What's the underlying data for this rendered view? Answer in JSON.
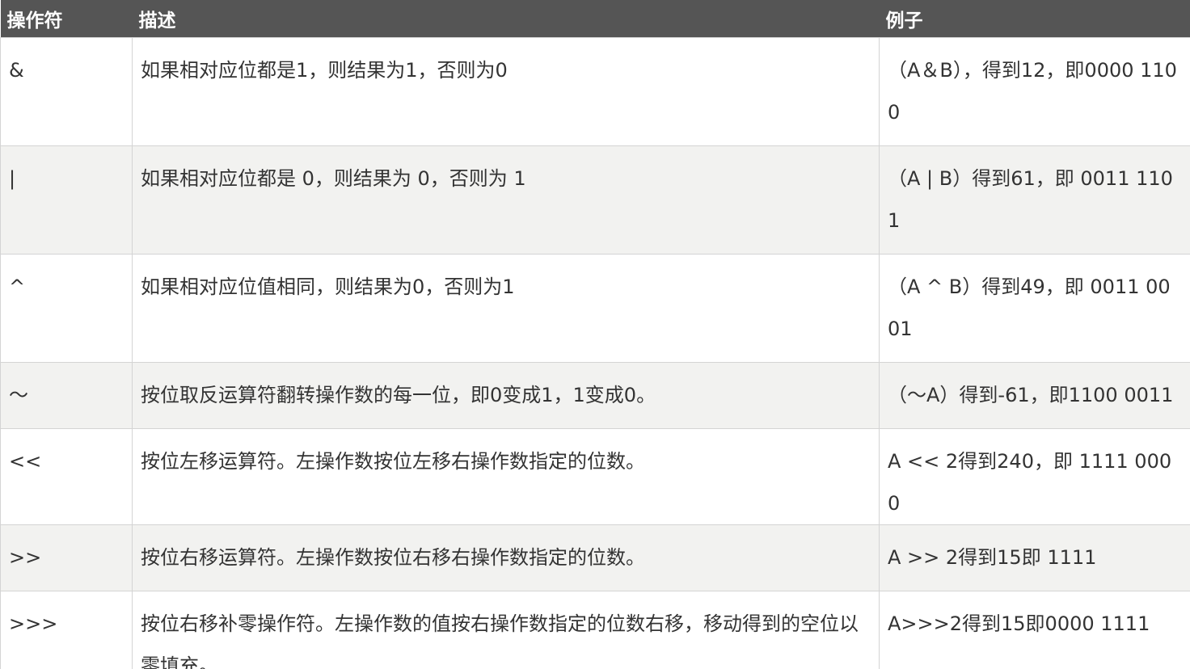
{
  "table": {
    "headers": [
      "操作符",
      "描述",
      "例子"
    ],
    "rows": [
      {
        "operator": "&",
        "description": "如果相对应位都是1，则结果为1，否则为0",
        "example": "（A＆B），得到12，即0000 1100"
      },
      {
        "operator": "|",
        "description": "如果相对应位都是 0，则结果为 0，否则为 1",
        "example": "（A | B）得到61，即 0011 1101"
      },
      {
        "operator": "^",
        "description": "如果相对应位值相同，则结果为0，否则为1",
        "example": "（A ^ B）得到49，即 0011 0001"
      },
      {
        "operator": "〜",
        "description": "按位取反运算符翻转操作数的每一位，即0变成1，1变成0。",
        "example": "（〜A）得到-61，即1100 0011"
      },
      {
        "operator": "<<",
        "description": "按位左移运算符。左操作数按位左移右操作数指定的位数。",
        "example": "A << 2得到240，即 1111 0000"
      },
      {
        "operator": ">>",
        "description": "按位右移运算符。左操作数按位右移右操作数指定的位数。",
        "example": "A >> 2得到15即 1111"
      },
      {
        "operator": ">>>",
        "description": "按位右移补零操作符。左操作数的值按右操作数指定的位数右移，移动得到的空位以零填充。",
        "example": "A>>>2得到15即0000 1111"
      }
    ]
  }
}
